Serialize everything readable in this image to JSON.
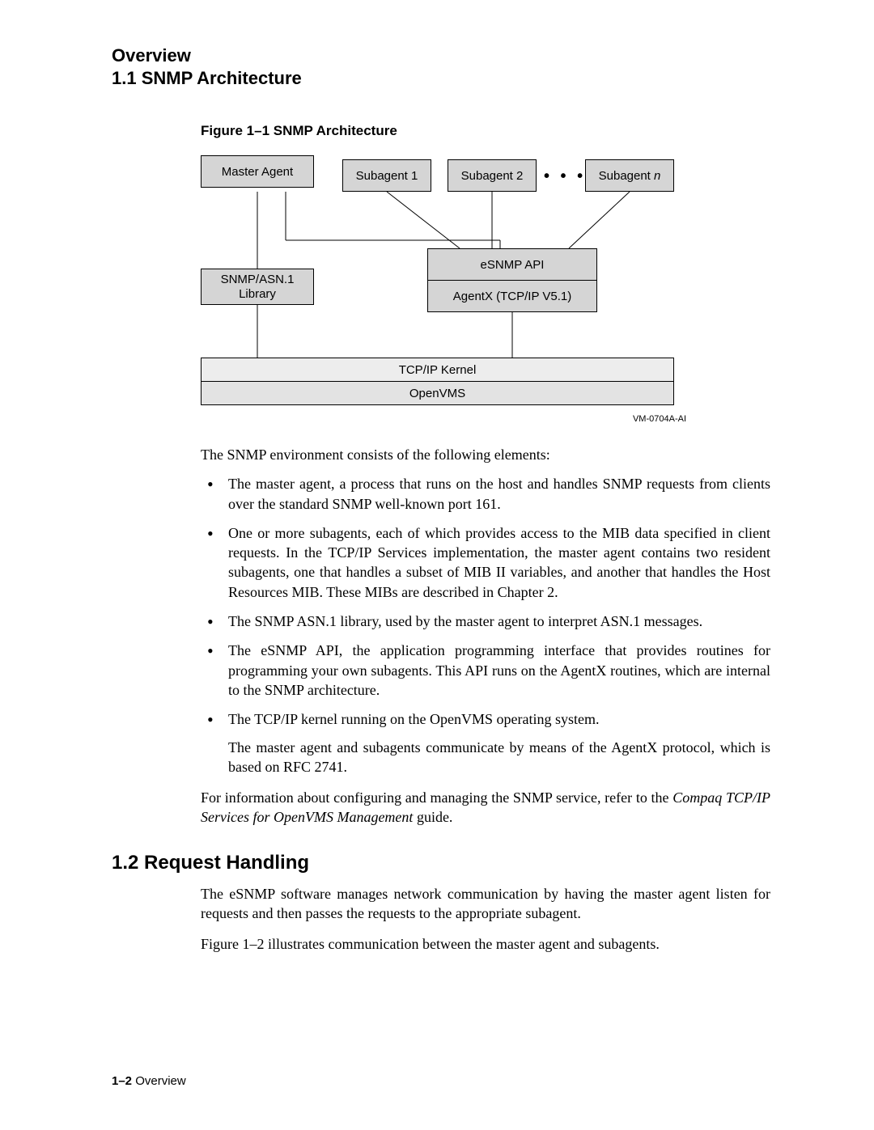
{
  "header": {
    "line1": "Overview",
    "line2": "1.1 SNMP Architecture"
  },
  "figure": {
    "caption": "Figure 1–1  SNMP Architecture",
    "boxes": {
      "master": "Master Agent",
      "sub1": "Subagent 1",
      "sub2": "Subagent 2",
      "subn": "Subagent n",
      "lib1": "SNMP/ASN.1",
      "lib2": "Library",
      "api": "eSNMP API",
      "agentx": "AgentX (TCP/IP V5.1)",
      "kernel": "TCP/IP Kernel",
      "openvms": "OpenVMS"
    },
    "ellipsis": "• • •",
    "id": "VM-0704A-AI"
  },
  "intro": "The SNMP environment consists of the following elements:",
  "bullets": [
    "The master agent, a process that runs on the host and handles SNMP requests from clients over the standard SNMP well-known port 161.",
    "One or more subagents, each of which provides access to the MIB data specified in client requests.  In the TCP/IP Services implementation, the master agent contains two resident subagents, one that handles a subset of MIB II variables, and another that handles the Host Resources MIB. These MIBs are described in Chapter 2.",
    "The SNMP ASN.1 library, used by the master agent to interpret ASN.1 messages.",
    "The eSNMP API, the application programming interface that provides routines for programming your own subagents.  This API runs on the AgentX routines, which are internal to the SNMP architecture.",
    "The TCP/IP kernel running on the OpenVMS operating system."
  ],
  "bullet5_sub": "The master agent and subagents communicate by means of the AgentX protocol, which is based on RFC 2741.",
  "afterlist": {
    "pre": "For information about configuring and managing the SNMP service, refer to the ",
    "ital": "Compaq TCP/IP Services for OpenVMS Management",
    "post": " guide."
  },
  "section2": {
    "heading": "1.2  Request Handling",
    "para1": "The eSNMP software manages network communication by having the master agent listen for requests and then passes the requests to the appropriate subagent.",
    "para2": "Figure 1–2 illustrates communication between the master agent and subagents."
  },
  "footer": {
    "pagenum": "1–2",
    "label": "  Overview"
  }
}
